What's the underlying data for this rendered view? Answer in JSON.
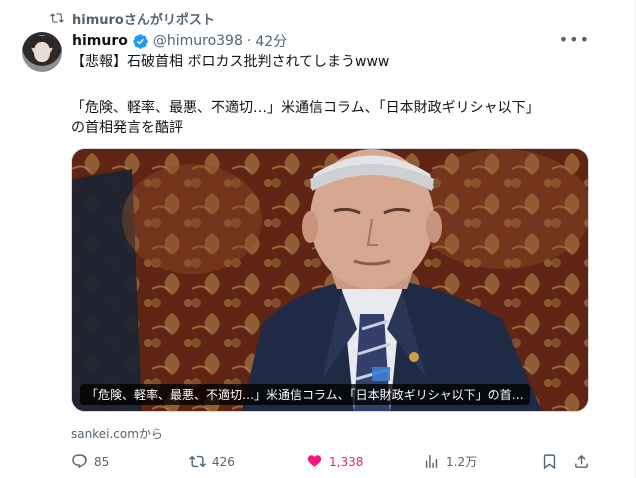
{
  "repost": {
    "label": "himuroさんがリポスト"
  },
  "author": {
    "name": "himuro",
    "handle": "@himuro398",
    "separator": "·",
    "time": "42分"
  },
  "post": {
    "line1": "【悲報】石破首相 ボロカス批判されてしまうwww",
    "line2": "「危険、軽率、最悪、不適切…」米通信コラム、「日本財政ギリシャ以下」",
    "line3": "の首相発言を酷評"
  },
  "card": {
    "caption": "「危険、軽率、最悪、不適切…」米通信コラム、「日本財政ギリシャ以下」の首…",
    "source": "sankei.comから"
  },
  "actions": {
    "replies": "85",
    "reposts": "426",
    "likes": "1,338",
    "views": "1.2万"
  },
  "colors": {
    "accent": "#1d9bf0",
    "like": "#f91880",
    "muted": "#536471"
  },
  "icons": [
    "repost-icon",
    "verified-badge-icon",
    "more-icon",
    "reply-icon",
    "heart-icon",
    "views-icon",
    "bookmark-icon",
    "share-icon"
  ]
}
